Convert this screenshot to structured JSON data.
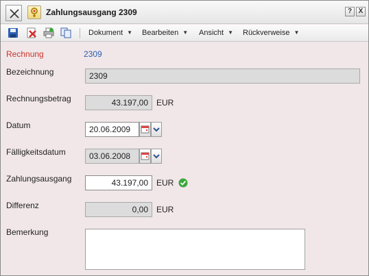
{
  "window": {
    "title": "Zahlungsausgang 2309"
  },
  "titlebar_buttons": {
    "help": "?",
    "close": "X"
  },
  "toolbar": {
    "menus": [
      {
        "label": "Dokument"
      },
      {
        "label": "Bearbeiten"
      },
      {
        "label": "Ansicht"
      },
      {
        "label": "Rückverweise"
      }
    ]
  },
  "form": {
    "rechnung": {
      "label": "Rechnung",
      "value": "2309"
    },
    "bezeichnung": {
      "label": "Bezeichnung",
      "value": "2309"
    },
    "rechnungsbetrag": {
      "label": "Rechnungsbetrag",
      "value": "43.197,00",
      "unit": "EUR"
    },
    "datum": {
      "label": "Datum",
      "value": "20.06.2009"
    },
    "faelligkeitsdatum": {
      "label": "Fälligkeitsdatum",
      "value": "03.06.2008"
    },
    "zahlungsausgang": {
      "label": "Zahlungsausgang",
      "value": "43.197,00",
      "unit": "EUR"
    },
    "differenz": {
      "label": "Differenz",
      "value": "0,00",
      "unit": "EUR"
    },
    "bemerkung": {
      "label": "Bemerkung",
      "value": ""
    }
  },
  "colors": {
    "background": "#f1e7e8",
    "required_label": "#c9332e",
    "link": "#2a5db0",
    "ok": "#3aa83a"
  }
}
